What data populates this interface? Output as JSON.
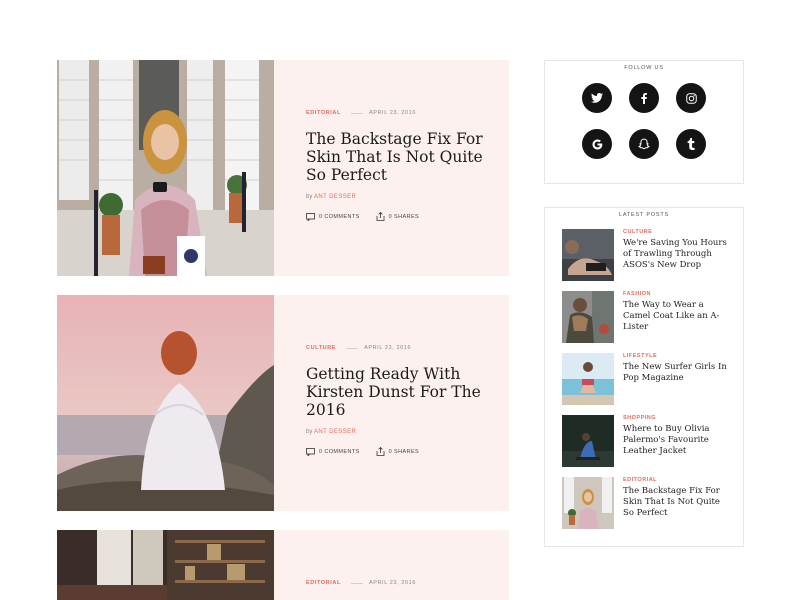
{
  "posts": [
    {
      "category": "Editorial",
      "date": "April 23, 2016",
      "title": "The Backstage Fix For Skin That Is Not Quite So Perfect",
      "by": "by",
      "author": "Ant Desser",
      "comments": "0 Comments",
      "shares": "0 Shares",
      "image": "woman-with-phone-photo"
    },
    {
      "category": "Culture",
      "date": "April 23, 2016",
      "title": "Getting Ready With Kirsten Dunst For The 2016",
      "by": "by",
      "author": "Ant Desser",
      "comments": "0 Comments",
      "shares": "0 Shares",
      "image": "woman-on-rock-sunset-photo"
    },
    {
      "category": "Editorial",
      "date": "April 23, 2016",
      "image": "library-interior-photo"
    }
  ],
  "sidebar": {
    "follow": {
      "title": "Follow Us",
      "icons": [
        {
          "name": "twitter-icon",
          "glyph": "t"
        },
        {
          "name": "facebook-icon",
          "glyph": "f"
        },
        {
          "name": "instagram-icon",
          "glyph": ""
        },
        {
          "name": "google-icon",
          "glyph": "G"
        },
        {
          "name": "snapchat-icon",
          "glyph": ""
        },
        {
          "name": "tumblr-icon",
          "glyph": "t"
        }
      ]
    },
    "latest": {
      "title": "Latest Posts",
      "items": [
        {
          "category": "Culture",
          "title": "We're Saving You Hours of Trawling Through ASOS's New Drop"
        },
        {
          "category": "Fashion",
          "title": "The Way to Wear a Camel Coat Like an A-Lister"
        },
        {
          "category": "Lifestyle",
          "title": "The New Surfer Girls In Pop Magazine"
        },
        {
          "category": "Shopping",
          "title": "Where to Buy Olivia Palermo's Favourite Leather Jacket"
        },
        {
          "category": "Editorial",
          "title": "The Backstage Fix For Skin That Is Not Quite So Perfect"
        }
      ]
    }
  },
  "colors": {
    "accent": "#e36b5b",
    "card_bg": "#fdf1ef",
    "social_bg": "#141414"
  }
}
